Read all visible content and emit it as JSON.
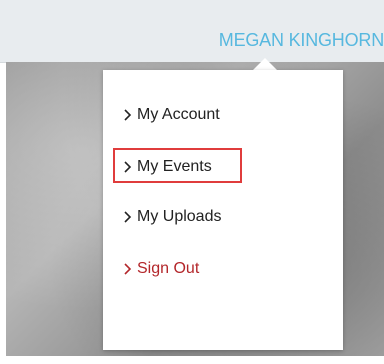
{
  "header": {
    "username": "MEGAN KINGHORN"
  },
  "user_menu": {
    "items": [
      {
        "label": "My Account",
        "icon": "chevron-right-icon"
      },
      {
        "label": "My Events",
        "icon": "chevron-right-icon",
        "highlighted": true
      },
      {
        "label": "My Uploads",
        "icon": "chevron-right-icon"
      },
      {
        "label": "Sign Out",
        "icon": "chevron-right-icon",
        "color": "#b3262a"
      }
    ]
  },
  "colors": {
    "username": "#57b8df",
    "highlight_border": "#e03c3c",
    "sign_out": "#b3262a"
  }
}
